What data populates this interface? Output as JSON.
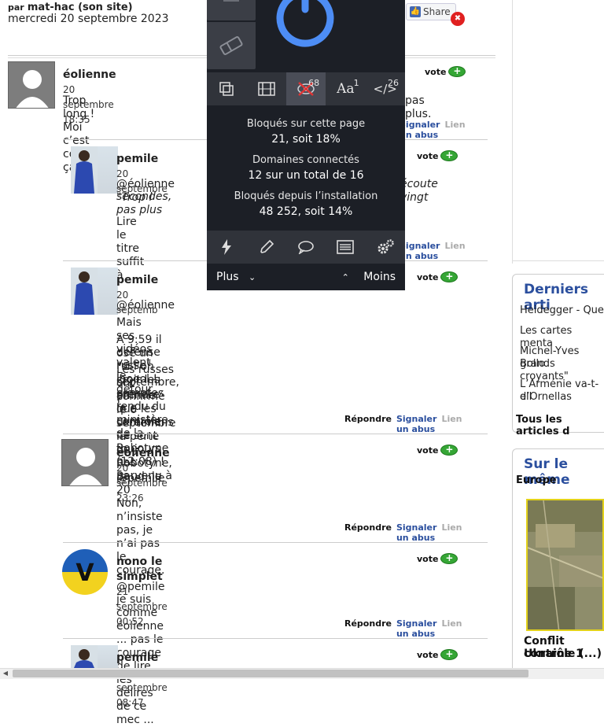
{
  "article": {
    "by_prefix": "par",
    "author": "mat-hac (son site)",
    "date": "mercredi 20 septembre 2023",
    "share_label": "Share"
  },
  "comments": [
    {
      "author": "éolienne",
      "date": "20 septembre 18:35",
      "vote": "vote",
      "lines": [
        "Trop long ! Moi c’est comme ça",
        "pas plus."
      ],
      "actions": {
        "report": "Signaler un abus",
        "link": "Lien"
      }
    },
    {
      "author": "pemile",
      "date": "20 septembre",
      "vote": "vote",
      "lines": [
        "@éolienne",
        "\"Trop l",
        "écoute vingt",
        "secondes, pas plus",
        "Lire le titre suffit à"
      ],
      "actions": {
        "report": "Signaler un abus",
        "link": "Lien"
      }
    },
    {
      "author": "pemile",
      "date": "20 septemb",
      "vote": "vote",
      "lines": [
        "@éolienne",
        "Mais ses vidéos valent le détour !",
        "A 9:59 il ose un \"si l’on croit les comptes rendu du ministère de la",
        "défense russe\" looool !",
        "Les russes ont confirmé le 6 septembre la perte de Robotyne, Baud, le 20",
        "septembre, affirme que les ukrainiens ne sont toujours pas parvenu à",
        "prendre le contrôle de Robotyne (12:08) !"
      ],
      "actions": {
        "reply": "Répondre",
        "report": "Signaler un abus",
        "link": "Lien"
      }
    },
    {
      "author": "éolienne",
      "date": "20 septembre 23:26",
      "vote": "vote",
      "lines": [
        "@pemile",
        ".",
        "Non, n’insiste pas, je n’ai pas le courage."
      ],
      "actions": {
        "reply": "Répondre",
        "report": "Signaler un abus",
        "link": "Lien"
      }
    },
    {
      "author": "nono le simplet",
      "date": "21 septembre 00:52",
      "vote": "vote",
      "lines": [
        "@pemile",
        "je suis comme éolienne ... pas le courage de lire les délires de ce mec ..."
      ],
      "actions": {
        "reply": "Répondre",
        "report": "Signaler un abus",
        "link": "Lien"
      }
    },
    {
      "author": "pemile",
      "date": "21 septembre 08:47",
      "vote": "vote",
      "lines": [],
      "actions": {}
    }
  ],
  "sidebar": {
    "latest_title": "Derniers arti",
    "latest_items": [
      "Heidegger - Que",
      "Les cartes menta",
      "Michel-Yves Bollo",
      "grands croyants\"",
      "L’Arménie va-t-ell",
      "d’Ornellas"
    ],
    "latest_all": "Tous les articles d",
    "same_title": "Sur le même",
    "same_category": "Europe",
    "same_article_title": [
      "Conflit Ukraine 1",
      "contrôle (...)"
    ]
  },
  "popup": {
    "tools": [
      {
        "icon": "element-zapper-icon",
        "glyph": "⧉",
        "badge": ""
      },
      {
        "icon": "media-film-icon",
        "glyph": "▦",
        "badge": ""
      },
      {
        "icon": "eye-blocked-icon",
        "glyph": "◉",
        "badge": "68"
      },
      {
        "icon": "font-icon",
        "glyph": "Aa",
        "badge": "1"
      },
      {
        "icon": "code-icon",
        "glyph": "</>",
        "badge": "26"
      }
    ],
    "stats": [
      {
        "label": "Bloqués sur cette page",
        "value": "21, soit 18%"
      },
      {
        "label": "Domaines connectés",
        "value": "12 sur un total de 16"
      },
      {
        "label": "Bloqués depuis l’installation",
        "value": "48 252, soit 14%"
      }
    ],
    "more_label": "Plus",
    "less_label": "Moins"
  },
  "colors": {
    "popup_bg": "#1c1f26",
    "power_blue": "#4d8df5",
    "report_link": "#2b4f9e",
    "vote_green": "#35a635"
  }
}
